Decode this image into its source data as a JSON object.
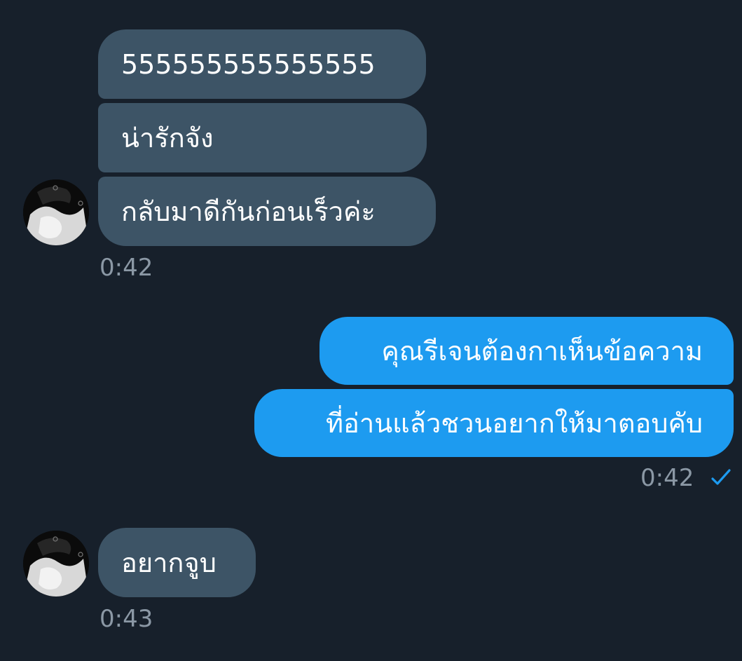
{
  "conversation": {
    "incoming_group_1": {
      "messages": [
        "555555555555555",
        "น่ารักจัง",
        "กลับมาดีกันก่อนเร็วค่ะ"
      ],
      "time": "0:42"
    },
    "outgoing_group": {
      "messages": [
        "คุณรีเจนต้องกาเห็นข้อความ",
        "ที่อ่านแล้วชวนอยากให้มาตอบคับ"
      ],
      "time": "0:42",
      "status_icon": "check-icon"
    },
    "incoming_group_2": {
      "messages": [
        "อยากจูบ"
      ],
      "time": "0:43"
    }
  },
  "colors": {
    "background": "#17202b",
    "incoming_bubble": "#3d5466",
    "outgoing_bubble": "#1d9bf0",
    "timestamp": "#8b98a5",
    "read_check": "#1d9bf0"
  }
}
